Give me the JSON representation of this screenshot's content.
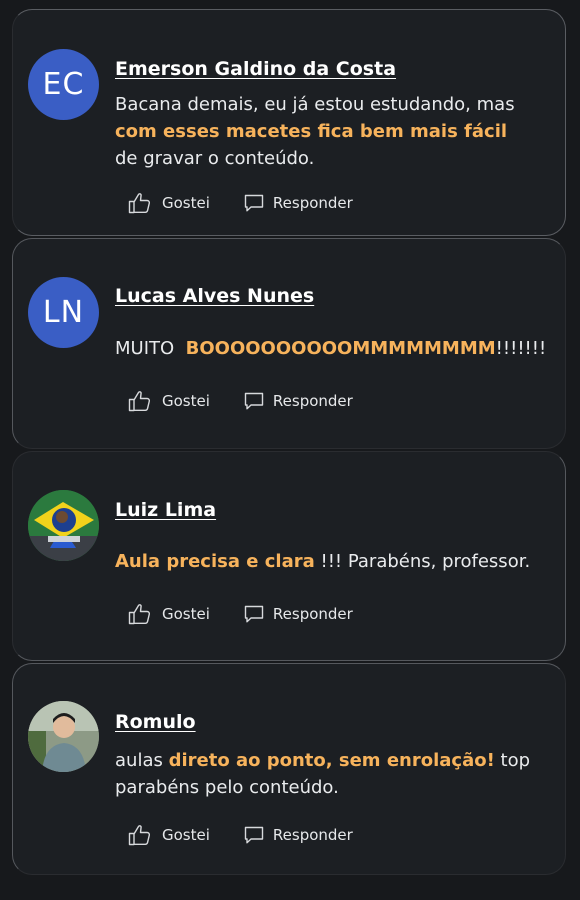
{
  "comments": [
    {
      "initials": "EC",
      "author": "Emerson Galdino da Costa",
      "text_before": "Bacana demais, eu já estou estudando, mas ",
      "text_highlight": "com esses macetes fica bem mais fácil",
      "text_after": " de gravar o conteúdo.",
      "like_label": "Gostei",
      "reply_label": "Responder"
    },
    {
      "initials": "LN",
      "author": "Lucas Alves Nunes",
      "text_before": "MUITO  ",
      "text_highlight": "BOOOOOOOOOOMMMMMMMM",
      "text_after": "!!!!!!!",
      "like_label": "Gostei",
      "reply_label": "Responder"
    },
    {
      "author": "Luiz Lima",
      "text_before": "",
      "text_highlight": "Aula precisa e clara",
      "text_after": " !!! Parabéns, professor.",
      "like_label": "Gostei",
      "reply_label": "Responder"
    },
    {
      "author": "Romulo",
      "text_before": "aulas ",
      "text_highlight": "direto ao ponto, sem enrolação!",
      "text_after": " top parabéns pelo conteúdo.",
      "like_label": "Gostei",
      "reply_label": "Responder"
    }
  ],
  "colors": {
    "background": "#17191c",
    "card": "#1c1f23",
    "avatar_initials_bg": "#3a5ec5",
    "highlight": "#f7b35c"
  },
  "icons": {
    "like": "thumbs-up-icon",
    "reply": "speech-bubble-icon"
  }
}
